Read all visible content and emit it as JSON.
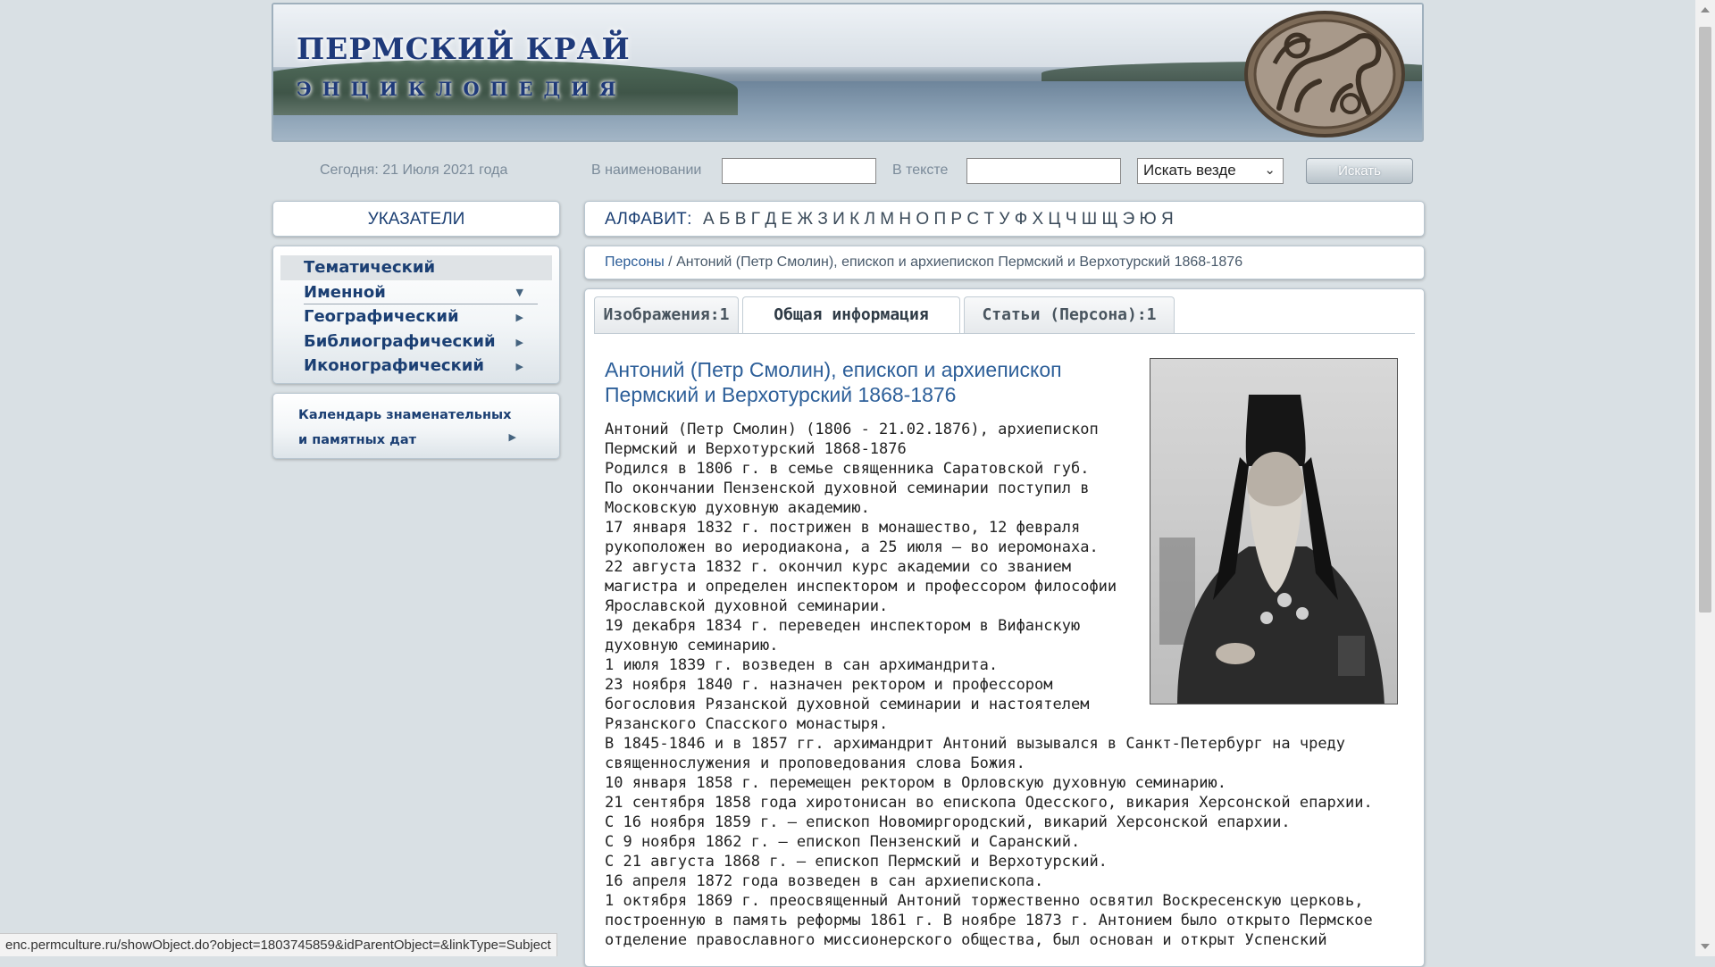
{
  "header": {
    "brand_title": "ПЕРМСКИЙ КРАЙ",
    "brand_subtitle": "ЭНЦИКЛОПЕДИЯ"
  },
  "search": {
    "date_text": "Сегодня: 21 Июля 2021 года",
    "name_label": "В наименовании",
    "name_value": "",
    "text_label": "В тексте",
    "text_value": "",
    "scope_selected": "Искать везде",
    "button_label": "Искать"
  },
  "sidebar": {
    "pointers_title": "УКАЗАТЕЛИ",
    "items": [
      {
        "label": "Тематический",
        "active": true
      },
      {
        "label": "Именной",
        "expanded": true
      },
      {
        "label": "Географический"
      },
      {
        "label": "Библиографический"
      },
      {
        "label": "Иконографический"
      }
    ],
    "calendar_label": "Календарь знаменательных и памятных дат"
  },
  "alphabet": {
    "label": "АЛФАВИТ:",
    "letters": [
      "А",
      "Б",
      "В",
      "Г",
      "Д",
      "Е",
      "Ж",
      "З",
      "И",
      "К",
      "Л",
      "М",
      "Н",
      "О",
      "П",
      "Р",
      "С",
      "Т",
      "У",
      "Ф",
      "Х",
      "Ц",
      "Ч",
      "Ш",
      "Щ",
      "Э",
      "Ю",
      "Я"
    ]
  },
  "breadcrumb": {
    "link": "Персоны",
    "separator": " / ",
    "current": "Антоний (Петр Смолин), епископ и архиепископ Пермский и Верхотурский 1868-1876"
  },
  "tabs": [
    {
      "label": "Изображения:1"
    },
    {
      "label": "Общая информация",
      "active": true
    },
    {
      "label": "Статьи (Персона):1"
    }
  ],
  "article": {
    "title": "Антоний (Петр Смолин), епископ и архиепископ Пермский и Верхотурский 1868-1876",
    "paragraphs": [
      "Антоний (Петр Смолин) (1806 - 21.02.1876), архиепископ Пермский и Верхотурский 1868-1876",
      "Родился в 1806 г. в семье священника Саратовской губ.",
      "По окончании Пензенской духовной семинарии поступил в Московскую духовную академию.",
      "17 января 1832 г. пострижен в монашество, 12 февраля рукоположен во иеродиакона, а 25 июля — во иеромонаха.",
      "22 августа 1832 г. окончил курс академии со званием магистра и определен инспектором и профессором философии Ярославской духовной семинарии.",
      "19 декабря 1834 г. переведен инспектором в Вифанскую духовную семинарию.",
      "1 июля 1839 г. возведен в сан архимандрита.",
      "23 ноября 1840 г. назначен ректором и профессором богословия Рязанской духовной семинарии и настоятелем Рязанского Спасского монастыря.",
      "В 1845-1846 и в 1857 гг. архимандрит Антоний вызывался в Санкт-Петербург на чреду священнослужения и проповедования слова Божия.",
      "10 января 1858 г. перемещен ректором в Орловскую духовную семинарию.",
      "21 сентября 1858 года хиротонисан во епископа Одесского, викария Херсонской епархии.",
      "С 16 ноября 1859 г. — епископ Новомиргородский, викарий Херсонской епархии.",
      "С 9 ноября 1862 г. — епископ Пензенский и Саранский.",
      "С 21 августа 1868 г. — епископ Пермский и Верхотурский.",
      "16 апреля 1872 года возведен в сан архиепископа.",
      "1 октября 1869 г. преосвященный Антоний торжественно освятил Воскресенскую церковь, построенную в память реформы 1861 г. В ноябре 1873 г. Антонием было открыто Пермское отделение православного миссионерского общества, был основан и открыт Успенский"
    ]
  },
  "status_bar": {
    "url": "enc.permculture.ru/showObject.do?object=1803745859&idParentObject=&linkType=Subject"
  },
  "colors": {
    "accent": "#1b3f73",
    "link": "#2d5f99",
    "page_bg": "#d9e0e4"
  }
}
